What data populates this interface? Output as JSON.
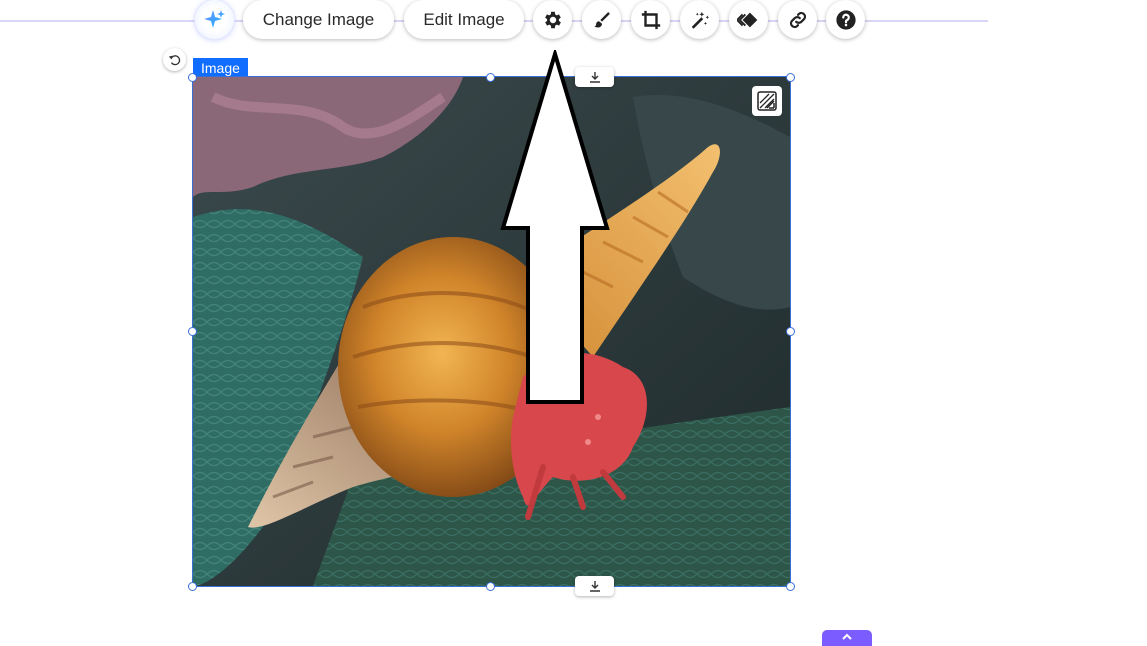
{
  "toolbar": {
    "change_image_label": "Change Image",
    "edit_image_label": "Edit Image",
    "icons": [
      "ai-sparkle-icon",
      "gear-icon",
      "brush-icon",
      "crop-icon",
      "magic-wand-icon",
      "animation-icon",
      "link-icon",
      "help-icon"
    ]
  },
  "element": {
    "tag_label": "Image"
  },
  "colors": {
    "accent": "#116dff",
    "selection": "#3a6fd8",
    "guide": "#d8d6f5",
    "purple_tab": "#7b5cff"
  }
}
